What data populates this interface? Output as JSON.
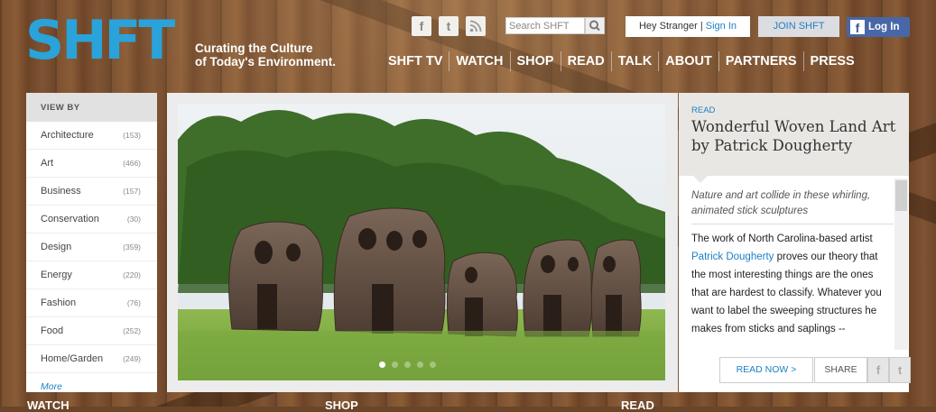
{
  "header": {
    "logo": "SHFT",
    "tagline_line1": "Curating the Culture",
    "tagline_line2": "of Today's Environment.",
    "search_placeholder": "Search SHFT",
    "greeting": "Hey Stranger | ",
    "sign_in": "Sign In",
    "join": "JOIN SHFT",
    "fb_login": "Log In",
    "social": [
      "facebook-icon",
      "twitter-icon",
      "rss-icon"
    ]
  },
  "nav": [
    "SHFT TV",
    "WATCH",
    "SHOP",
    "READ",
    "TALK",
    "ABOUT",
    "PARTNERS",
    "PRESS"
  ],
  "viewby": {
    "heading": "VIEW BY",
    "items": [
      {
        "label": "Architecture",
        "count": "(153)"
      },
      {
        "label": "Art",
        "count": "(466)"
      },
      {
        "label": "Business",
        "count": "(157)"
      },
      {
        "label": "Conservation",
        "count": "(30)"
      },
      {
        "label": "Design",
        "count": "(359)"
      },
      {
        "label": "Energy",
        "count": "(220)"
      },
      {
        "label": "Fashion",
        "count": "(76)"
      },
      {
        "label": "Food",
        "count": "(252)"
      },
      {
        "label": "Home/Garden",
        "count": "(249)"
      }
    ],
    "more": "More"
  },
  "article": {
    "kicker": "READ",
    "headline": "Wonderful Woven Land Art by Patrick Dougherty",
    "deck": "Nature and art collide in these whirling, animated stick sculptures",
    "body_pre": "The work of North Carolina-based artist ",
    "body_link": "Patrick Dougherty",
    "body_post": " proves our theory that the most interesting things are the ones that are hardest to classify. Whatever you want to label the sweeping structures he makes from sticks and saplings --",
    "read_now": "READ NOW >",
    "share": "SHARE"
  },
  "bottom": [
    "WATCH",
    "SHOP",
    "READ"
  ],
  "colors": {
    "brand_blue": "#29a3d9",
    "link_blue": "#1f7fc4",
    "facebook": "#4767a8"
  }
}
